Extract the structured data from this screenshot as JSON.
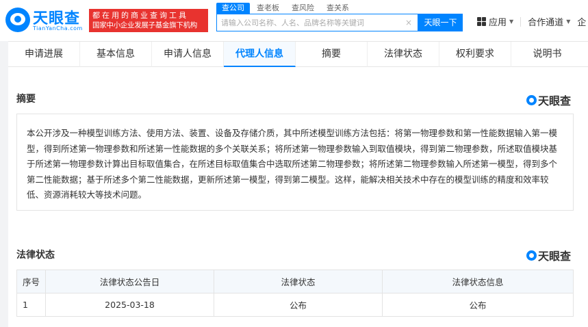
{
  "header": {
    "logo_text": "天眼查",
    "logo_sub": "TianYanCha.com",
    "slogan_line1": "都在用的商业查询工具",
    "slogan_line2": "国家中小企业发展子基金旗下机构",
    "search_tabs": [
      {
        "label": "查公司",
        "active": true
      },
      {
        "label": "查老板",
        "active": false
      },
      {
        "label": "查风险",
        "active": false
      },
      {
        "label": "查关系",
        "active": false
      }
    ],
    "search_placeholder": "请输入公司名称、人名、品牌名称等关键词",
    "search_button": "天眼一下",
    "nav": {
      "apps": "应用",
      "cooperation": "合作通道",
      "more": "企"
    }
  },
  "tabs": [
    {
      "label": "申请进展",
      "active": false
    },
    {
      "label": "基本信息",
      "active": false
    },
    {
      "label": "申请人信息",
      "active": false
    },
    {
      "label": "代理人信息",
      "active": true
    },
    {
      "label": "摘要",
      "active": false
    },
    {
      "label": "法律状态",
      "active": false
    },
    {
      "label": "权利要求",
      "active": false
    },
    {
      "label": "说明书",
      "active": false
    }
  ],
  "abstract": {
    "title": "摘要",
    "brand": "天眼查",
    "text": "本公开涉及一种模型训练方法、使用方法、装置、设备及存储介质，其中所述模型训练方法包括：将第一物理参数和第一性能数据输入第一模型，得到所述第一物理参数和所述第一性能数据的多个关联关系；将所述第一物理参数输入到取值模块，得到第二物理参数，所述取值模块基于所述第一物理参数计算出目标取值集合，在所述目标取值集合中选取所述第二物理参数；将所述第二物理参数输入所述第一模型，得到多个第二性能数据；基于所述多个第二性能数据，更新所述第一模型，得到第二模型。这样，能解决相关技术中存在的模型训练的精度和效率较低、资源消耗较大等技术问题。"
  },
  "legal_status": {
    "title": "法律状态",
    "brand": "天眼查",
    "columns": [
      "序号",
      "法律状态公告日",
      "法律状态",
      "法律状态信息"
    ],
    "rows": [
      [
        "1",
        "2025-03-18",
        "公布",
        "公布"
      ]
    ]
  },
  "colors": {
    "brand_blue": "#0084ff",
    "slogan_red": "#e8332f"
  }
}
